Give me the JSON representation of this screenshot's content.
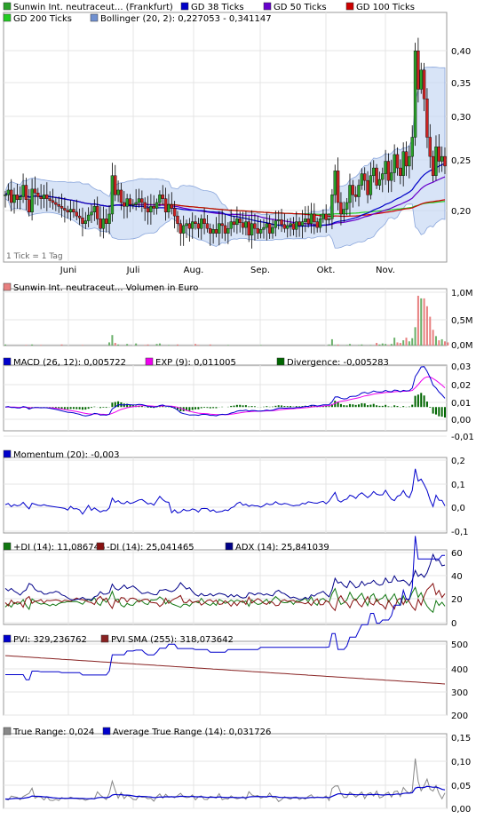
{
  "colors": {
    "price": "#2aa02a",
    "gd38": "#0000c8",
    "gd50": "#6600cc",
    "gd100": "#cc0000",
    "gd200": "#22cc22",
    "boll": "#c8d8f4",
    "vol_up": "#6ab06a",
    "vol_down": "#e88080",
    "macd": "#0000cc",
    "exp": "#ee00ee",
    "div": "#006600",
    "mom": "#0000cc",
    "pdi": "#117711",
    "mdi": "#881111",
    "adx": "#000088",
    "pvi": "#0000cc",
    "pvisma": "#882222",
    "tr": "#888888",
    "atr": "#0000cc"
  },
  "chart_data": [
    {
      "type": "candlestick",
      "legend": [
        {
          "label": "Sunwin Int. neutraceut... (Frankfurt)",
          "color": "#2aa02a"
        },
        {
          "label": "GD 38 Ticks",
          "color": "#0000c8"
        },
        {
          "label": "GD 50 Ticks",
          "color": "#6600cc"
        },
        {
          "label": "GD 100 Ticks",
          "color": "#cc0000"
        },
        {
          "label": "GD 200 Ticks",
          "color": "#22cc22"
        },
        {
          "label": "Bollinger (20, 2): 0,227053 - 0,341147",
          "color": "#7090d0"
        }
      ],
      "note": "1 Tick = 1 Tag",
      "x_labels": [
        "Juni",
        "Juli",
        "Aug.",
        "Sep.",
        "Okt.",
        "Nov."
      ],
      "y_ticks": [
        "0,40",
        "0,35",
        "0,30",
        "0,25",
        "0,20"
      ],
      "ylim": [
        0.17,
        0.43
      ],
      "close": [
        0.24,
        0.245,
        0.232,
        0.24,
        0.235,
        0.238,
        0.25,
        0.235,
        0.222,
        0.246,
        0.242,
        0.238,
        0.236,
        0.24,
        0.236,
        0.234,
        0.232,
        0.23,
        0.228,
        0.226,
        0.224,
        0.222,
        0.225,
        0.222,
        0.218,
        0.216,
        0.21,
        0.213,
        0.219,
        0.222,
        0.228,
        0.215,
        0.205,
        0.215,
        0.21,
        0.22,
        0.26,
        0.24,
        0.245,
        0.232,
        0.228,
        0.236,
        0.23,
        0.23,
        0.232,
        0.236,
        0.232,
        0.226,
        0.222,
        0.228,
        0.226,
        0.232,
        0.24,
        0.236,
        0.222,
        0.23,
        0.226,
        0.218,
        0.21,
        0.2,
        0.208,
        0.21,
        0.205,
        0.212,
        0.21,
        0.205,
        0.215,
        0.21,
        0.205,
        0.2,
        0.204,
        0.2,
        0.21,
        0.208,
        0.2,
        0.205,
        0.212,
        0.209,
        0.215,
        0.211,
        0.206,
        0.212,
        0.198,
        0.21,
        0.205,
        0.2,
        0.204,
        0.206,
        0.21,
        0.2,
        0.206,
        0.213,
        0.214,
        0.209,
        0.205,
        0.208,
        0.21,
        0.204,
        0.212,
        0.208,
        0.212,
        0.215,
        0.21,
        0.22,
        0.212,
        0.206,
        0.215,
        0.22,
        0.214,
        0.215,
        0.24,
        0.265,
        0.232,
        0.22,
        0.225,
        0.232,
        0.25,
        0.24,
        0.238,
        0.25,
        0.262,
        0.255,
        0.24,
        0.26,
        0.268,
        0.25,
        0.256,
        0.262,
        0.275,
        0.255,
        0.263,
        0.282,
        0.268,
        0.26,
        0.285,
        0.27,
        0.28,
        0.3,
        0.39,
        0.35,
        0.37,
        0.34,
        0.3,
        0.28,
        0.26,
        0.29,
        0.275,
        0.28,
        0.27
      ],
      "volume": [
        0.02,
        0,
        0,
        0,
        0,
        0,
        0,
        0.01,
        0,
        0.02,
        0,
        0,
        0.01,
        0,
        0,
        0,
        0,
        0,
        0,
        0.02,
        0,
        0,
        0,
        0,
        0,
        0,
        0.01,
        0,
        0,
        0,
        0,
        0,
        0,
        0,
        0,
        0.06,
        0.2,
        0.05,
        0.02,
        0,
        0,
        0.03,
        0,
        0,
        0.04,
        0,
        0,
        0.01,
        0.02,
        0,
        0,
        0.03,
        0.04,
        0,
        0,
        0.01,
        0,
        0,
        0.02,
        0,
        0,
        0,
        0,
        0,
        0.03,
        0.01,
        0,
        0,
        0,
        0.02,
        0,
        0,
        0,
        0,
        0,
        0.01,
        0,
        0,
        0,
        0,
        0,
        0,
        0,
        0,
        0,
        0,
        0.01,
        0,
        0,
        0,
        0,
        0,
        0,
        0,
        0,
        0,
        0,
        0,
        0,
        0,
        0,
        0,
        0,
        0,
        0,
        0,
        0,
        0,
        0,
        0.02,
        0.12,
        0.01,
        0.02,
        0,
        0,
        0.01,
        0.03,
        0,
        0,
        0.01,
        0.02,
        0,
        0,
        0.01,
        0,
        0.05,
        0.02,
        0.04,
        0.03,
        0.01,
        0.03,
        0.15,
        0.06,
        0.05,
        0.1,
        0.15,
        0.08,
        0.14,
        0.35,
        0.95,
        0.9,
        0.9,
        0.75,
        0.55,
        0.3,
        0.18,
        0.1,
        0.12,
        0.08,
        0.06
      ]
    },
    {
      "type": "bar",
      "legend": [
        {
          "label": "Sunwin Int. neutraceut... Volumen in Euro",
          "color": "#e88080"
        }
      ],
      "y_ticks": [
        "1,0M",
        "0,5M",
        "0,0M"
      ],
      "ylim": [
        0,
        1.0
      ]
    },
    {
      "type": "line",
      "legend": [
        {
          "label": "MACD (26, 12): 0,005722",
          "color": "#0000cc"
        },
        {
          "label": "EXP (9): 0,011005",
          "color": "#ee00ee"
        },
        {
          "label": "Divergence: -0,005283",
          "color": "#006600"
        }
      ],
      "y_ticks": [
        "0,03",
        "0,02",
        "0,01",
        "0,00",
        "-0,01"
      ],
      "ylim": [
        -0.017,
        0.03
      ]
    },
    {
      "type": "line",
      "legend": [
        {
          "label": "Momentum (20): -0,003",
          "color": "#0000cc"
        }
      ],
      "y_ticks": [
        "0,2",
        "0,1",
        "0,0",
        "-0,1"
      ],
      "ylim": [
        -0.12,
        0.2
      ]
    },
    {
      "type": "line",
      "legend": [
        {
          "label": "+DI (14): 11,086746",
          "color": "#117711"
        },
        {
          "label": "-DI (14): 25,041465",
          "color": "#881111"
        },
        {
          "label": "ADX (14): 25,841039",
          "color": "#000088"
        }
      ],
      "y_ticks": [
        "60",
        "40",
        "20",
        "0"
      ],
      "ylim": [
        0,
        60
      ]
    },
    {
      "type": "line",
      "legend": [
        {
          "label": "PVI: 329,236762",
          "color": "#0000cc"
        },
        {
          "label": "PVI SMA (255): 318,073642",
          "color": "#882222"
        }
      ],
      "y_ticks": [
        "500",
        "400",
        "300",
        "200"
      ],
      "ylim": [
        190,
        500
      ]
    },
    {
      "type": "line",
      "legend": [
        {
          "label": "True Range: 0,024",
          "color": "#888888"
        },
        {
          "label": "Average True Range (14): 0,031726",
          "color": "#0000cc"
        }
      ],
      "y_ticks": [
        "0,15",
        "0,10",
        "0,05",
        "0,00"
      ],
      "ylim": [
        -0.005,
        0.155
      ]
    }
  ]
}
